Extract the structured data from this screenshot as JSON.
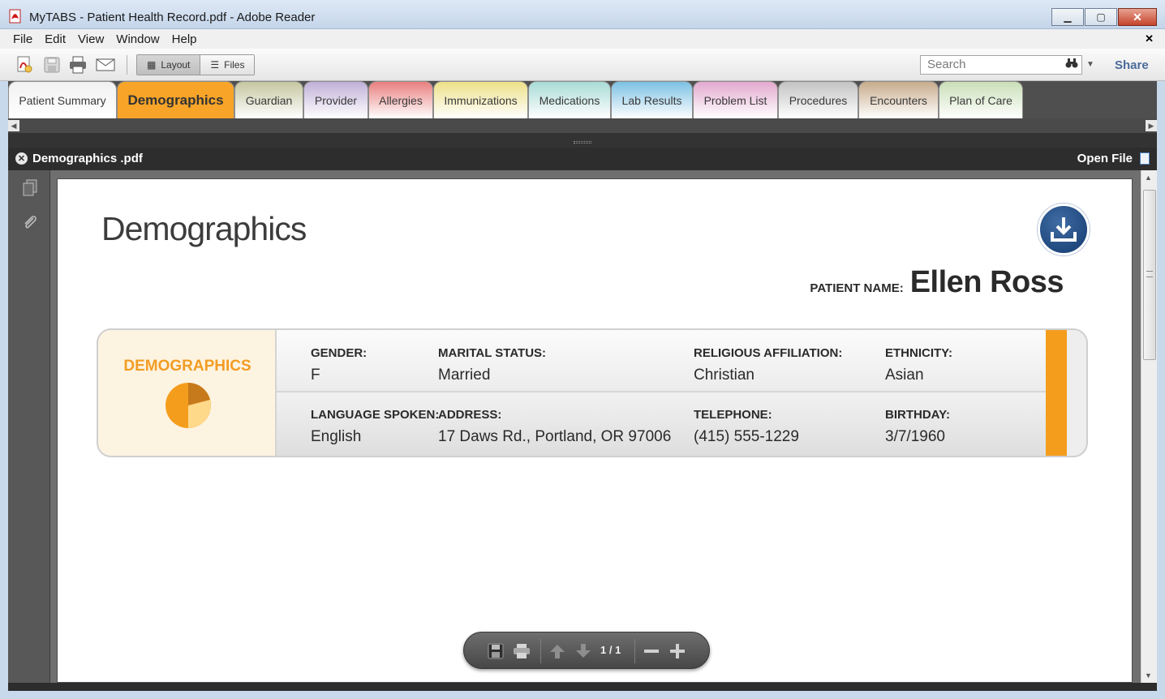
{
  "window": {
    "title": "MyTABS - Patient Health Record.pdf - Adobe Reader",
    "minimize_glyph": "▁",
    "maximize_glyph": "▢",
    "close_glyph": "✕"
  },
  "menu": {
    "items": [
      "File",
      "Edit",
      "View",
      "Window",
      "Help"
    ],
    "close_glyph": "✕"
  },
  "toolbar": {
    "layout_label": "Layout",
    "files_label": "Files",
    "search_placeholder": "Search",
    "share_label": "Share"
  },
  "tabs": [
    {
      "label": "Patient Summary",
      "color": "#f1f1f1"
    },
    {
      "label": "Demographics",
      "color": "#f7a428",
      "active": true
    },
    {
      "label": "Guardian",
      "color": "#c5c6a0"
    },
    {
      "label": "Provider",
      "color": "#bfb0d8"
    },
    {
      "label": "Allergies",
      "color": "#e97f7f"
    },
    {
      "label": "Immunizations",
      "color": "#ede089"
    },
    {
      "label": "Medications",
      "color": "#a9dbd6"
    },
    {
      "label": "Lab Results",
      "color": "#7cc1e4"
    },
    {
      "label": "Problem List",
      "color": "#e3a9cf"
    },
    {
      "label": "Procedures",
      "color": "#c3c3c3"
    },
    {
      "label": "Encounters",
      "color": "#c8ab8b"
    },
    {
      "label": "Plan of Care",
      "color": "#c9dfb8"
    }
  ],
  "document": {
    "filename": "Demographics .pdf",
    "open_file_label": "Open File"
  },
  "page": {
    "title": "Demographics",
    "patient_label": "PATIENT NAME:",
    "patient_name": "Ellen Ross",
    "card_label": "DEMOGRAPHICS",
    "fields": {
      "gender": {
        "label": "GENDER:",
        "value": "F"
      },
      "marital": {
        "label": "MARITAL STATUS:",
        "value": "Married"
      },
      "religion": {
        "label": "RELIGIOUS AFFILIATION:",
        "value": "Christian"
      },
      "ethnicity": {
        "label": "ETHNICITY:",
        "value": "Asian"
      },
      "language": {
        "label": "LANGUAGE SPOKEN:",
        "value": "English"
      },
      "address": {
        "label": "ADDRESS:",
        "value": "17 Daws Rd., Portland, OR 97006"
      },
      "telephone": {
        "label": "TELEPHONE:",
        "value": "(415) 555-1229"
      },
      "birthday": {
        "label": "BIRTHDAY:",
        "value": "3/7/1960"
      }
    }
  },
  "pager": {
    "page_indicator": "1 / 1"
  },
  "colors": {
    "accent_orange": "#f49d1d",
    "download_blue": "#1f4b85"
  }
}
